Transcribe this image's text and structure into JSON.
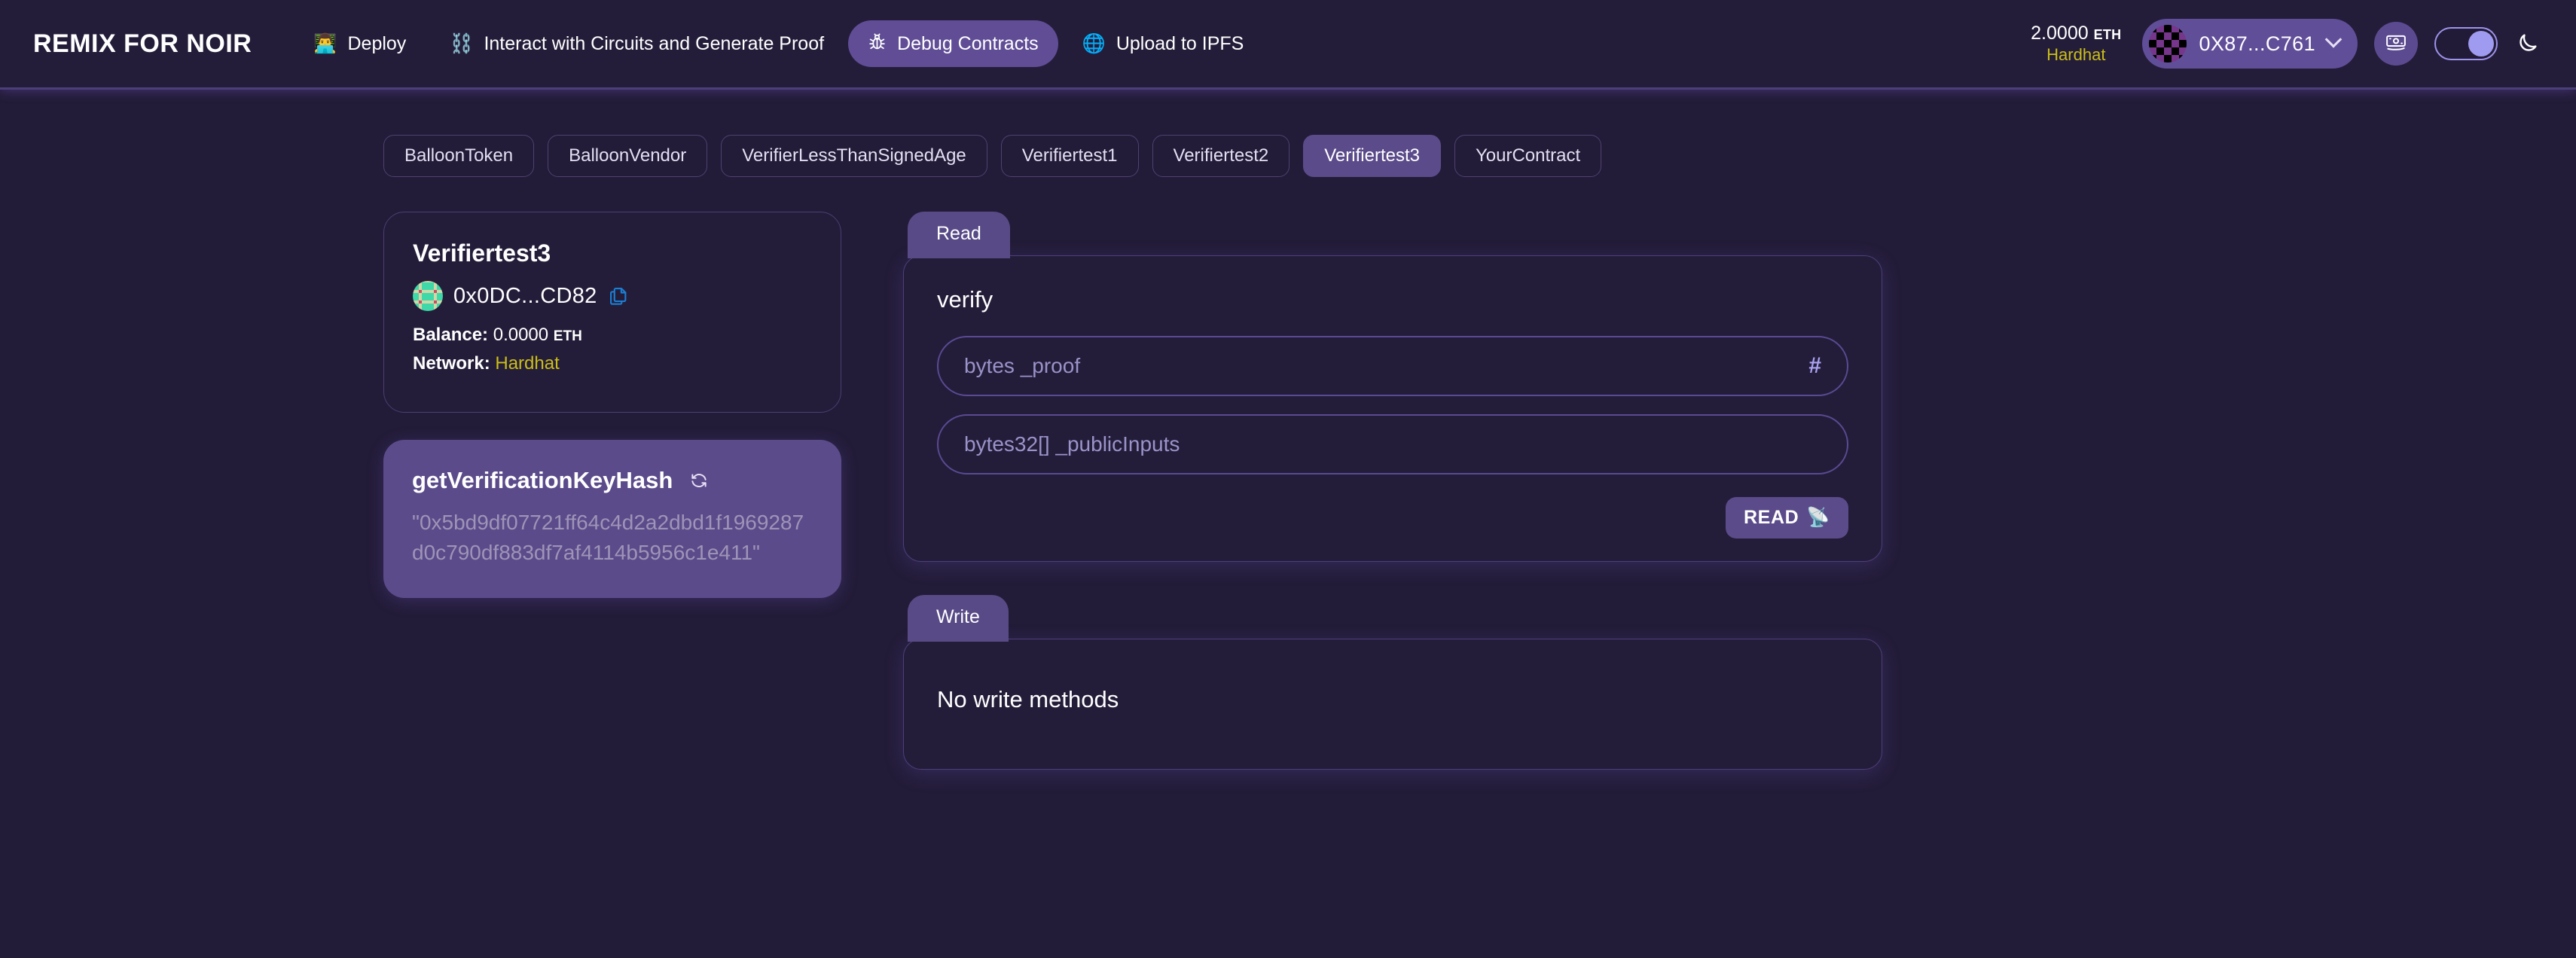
{
  "header": {
    "brand": "REMIX FOR NOIR",
    "nav": [
      {
        "label": "Deploy",
        "icon": "👨‍💻",
        "icon_name": "laptop-person-icon",
        "active": false
      },
      {
        "label": "Interact with Circuits and Generate Proof",
        "icon": "⛓️",
        "icon_name": "chains-icon",
        "active": false
      },
      {
        "label": "Debug Contracts",
        "icon": "🐛",
        "icon_name": "bug-icon",
        "active": true
      },
      {
        "label": "Upload to IPFS",
        "icon": "🌐",
        "icon_name": "globe-icon",
        "active": false
      }
    ],
    "balance_amount": "2.0000",
    "balance_unit": "ETH",
    "network": "Hardhat",
    "account_address": "0X87...C761",
    "faucet_icon": "banknote-icon",
    "theme_toggle_state": "on",
    "theme_icon": "moon-icon"
  },
  "contract_tabs": [
    {
      "label": "BalloonToken",
      "active": false
    },
    {
      "label": "BalloonVendor",
      "active": false
    },
    {
      "label": "VerifierLessThanSignedAge",
      "active": false
    },
    {
      "label": "Verifiertest1",
      "active": false
    },
    {
      "label": "Verifiertest2",
      "active": false
    },
    {
      "label": "Verifiertest3",
      "active": true
    },
    {
      "label": "YourContract",
      "active": false
    }
  ],
  "contract_card": {
    "name": "Verifiertest3",
    "address": "0x0DC...CD82",
    "copy_icon": "copy-icon",
    "balance_label": "Balance:",
    "balance_value": "0.0000",
    "balance_unit": "ETH",
    "network_label": "Network:",
    "network_value": "Hardhat"
  },
  "function_card": {
    "name": "getVerificationKeyHash",
    "refresh_icon": "refresh-icon",
    "value": "\"0x5bd9df07721ff64c4d2a2dbd1f1969287d0c790df883df7af4114b5956c1e411\""
  },
  "read_panel": {
    "tab_label": "Read",
    "function_name": "verify",
    "inputs": [
      {
        "placeholder": "bytes _proof",
        "value": "",
        "suffix_icon": "hash-icon"
      },
      {
        "placeholder": "bytes32[] _publicInputs",
        "value": "",
        "suffix_icon": ""
      }
    ],
    "button_label": "READ",
    "button_icon": "📡"
  },
  "write_panel": {
    "tab_label": "Write",
    "empty_message": "No write methods"
  },
  "colors": {
    "background": "#231c38",
    "panel": "#241d3a",
    "accent": "#5b4b8a",
    "accent_light": "#9e9bf0",
    "network_yellow": "#cbbe17",
    "muted_text": "#9e94b7",
    "link_blue": "#1a7fd4"
  }
}
